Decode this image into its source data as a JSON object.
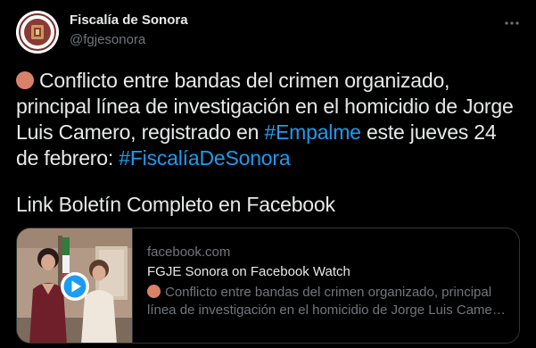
{
  "account": {
    "name": "Fiscalía de Sonora",
    "handle": "@fgjesonora"
  },
  "tweet": {
    "line1_rest": "Conflicto entre bandas del crimen organizado,",
    "line2": "principal línea de investigación en el homicidio de Jorge",
    "line3_before": "Luis Camero, registrado en ",
    "hashtag_empalme": "#Empalme",
    "line3_after": " este jueves 24",
    "line4_before": "de febrero: ",
    "hashtag_fiscalia": "#FiscalíaDeSonora",
    "link_text": "Link Boletín Completo en Facebook",
    "status_dot_color": "#d9826a"
  },
  "card": {
    "domain": "facebook.com",
    "title": "FGJE Sonora on Facebook Watch",
    "desc_line1": "Conflicto entre bandas del crimen organizado, principal",
    "desc_line2": "línea de investigación en el homicidio de Jorge Luis Camero,..."
  },
  "icons": {
    "more": "more-horizontal-icon",
    "play": "play-icon"
  },
  "colors": {
    "background": "#000000",
    "text": "#e7e9ea",
    "secondary": "#71767b",
    "hashtag": "#1d9bf0",
    "border": "#2f3336"
  }
}
